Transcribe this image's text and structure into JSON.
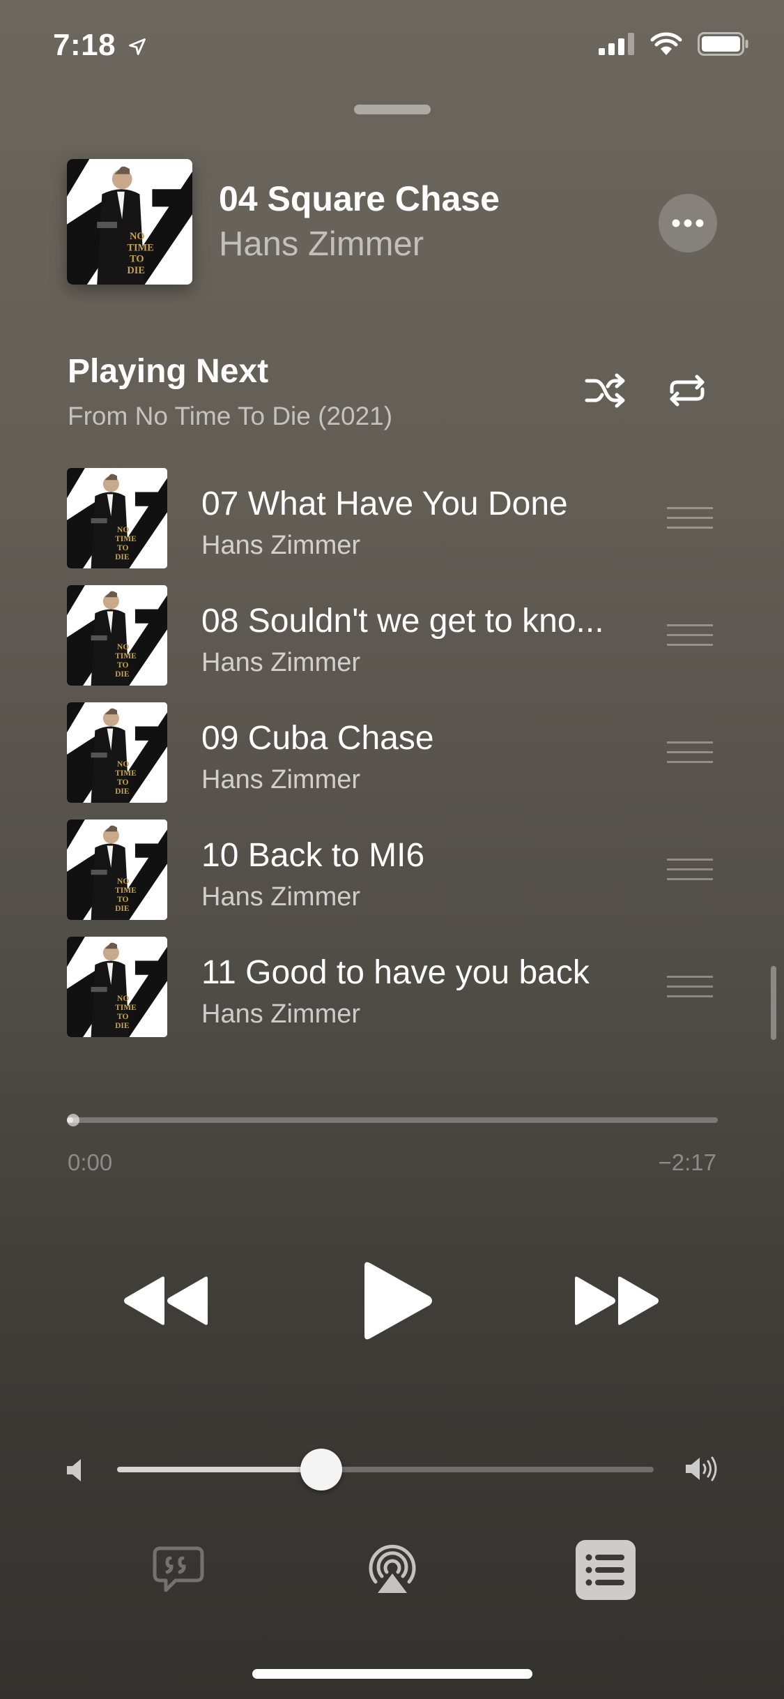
{
  "status_bar": {
    "time": "7:18"
  },
  "now_playing": {
    "title": "04 Square Chase",
    "artist": "Hans Zimmer"
  },
  "playing_next": {
    "heading": "Playing Next",
    "source": "From No Time To Die (2021)",
    "queue": [
      {
        "title": "07 What Have You Done",
        "artist": "Hans Zimmer"
      },
      {
        "title": "08 Souldn't we get to kno...",
        "artist": "Hans Zimmer"
      },
      {
        "title": "09 Cuba Chase",
        "artist": "Hans Zimmer"
      },
      {
        "title": "10 Back to MI6",
        "artist": "Hans Zimmer"
      },
      {
        "title": "11 Good to have you back",
        "artist": "Hans Zimmer"
      }
    ]
  },
  "progress": {
    "elapsed": "0:00",
    "remaining": "−2:17",
    "fraction": 0.0
  },
  "volume": {
    "fraction": 0.38
  },
  "icons": {
    "location": "location-arrow-icon",
    "signal": "cellular-signal-icon",
    "wifi": "wifi-icon",
    "battery": "battery-icon",
    "more": "ellipsis-icon",
    "shuffle": "shuffle-icon",
    "repeat": "repeat-icon",
    "reorder": "reorder-handle-icon",
    "rewind": "rewind-icon",
    "play": "play-icon",
    "fast_forward": "fast-forward-icon",
    "volume_low": "speaker-low-icon",
    "volume_high": "speaker-high-icon",
    "lyrics": "lyrics-icon",
    "airplay": "airplay-icon",
    "queue": "queue-list-icon"
  }
}
